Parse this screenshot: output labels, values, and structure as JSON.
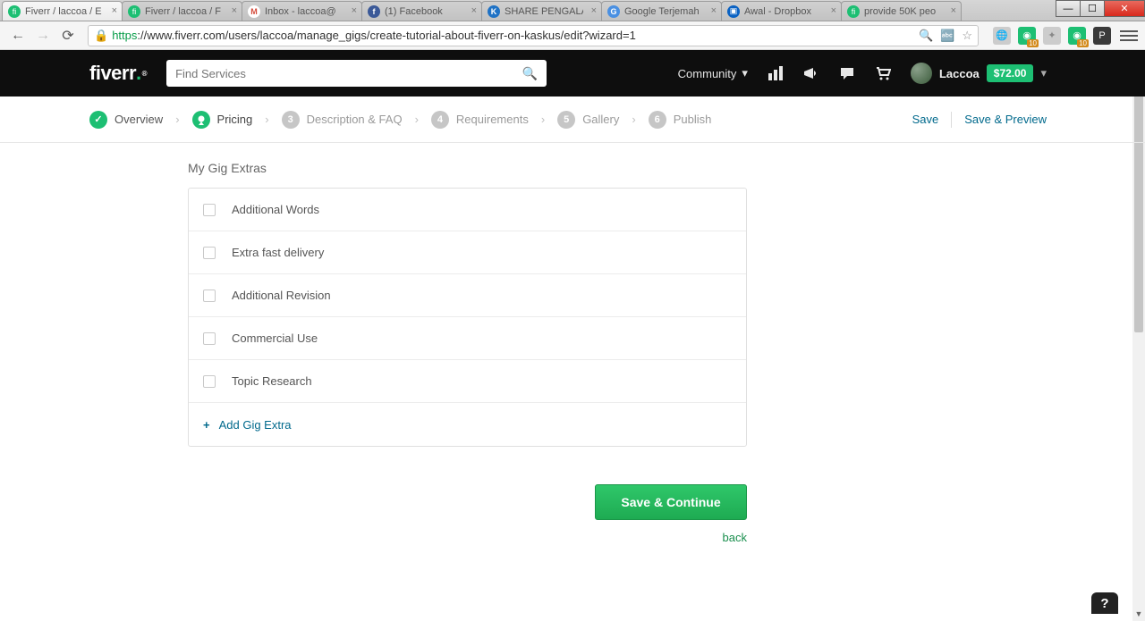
{
  "browser": {
    "tabs": [
      {
        "title": "Fiverr / laccoa / E",
        "favicon": "#1dbf73",
        "letter": "fi"
      },
      {
        "title": "Fiverr / laccoa / F",
        "favicon": "#1dbf73",
        "letter": "fi"
      },
      {
        "title": "Inbox - laccoa@",
        "favicon": "#ffffff",
        "letter": "M",
        "letterColor": "#d44a3a"
      },
      {
        "title": "(1) Facebook",
        "favicon": "#3b5998",
        "letter": "f"
      },
      {
        "title": "SHARE PENGALA",
        "favicon": "#1f72c5",
        "letter": "K"
      },
      {
        "title": "Google Terjemah",
        "favicon": "#4a90e2",
        "letter": "G"
      },
      {
        "title": "Awal - Dropbox",
        "favicon": "#0a62c3",
        "letter": "▣"
      },
      {
        "title": "provide 50K peo",
        "favicon": "#1dbf73",
        "letter": "fi"
      }
    ],
    "url_proto": "https",
    "url_rest": "://www.fiverr.com/users/laccoa/manage_gigs/create-tutorial-about-fiverr-on-kaskus/edit?wizard=1",
    "extensions": [
      {
        "bg": "#cccccc",
        "letter": "🌐",
        "badge": ""
      },
      {
        "bg": "#1dbf73",
        "letter": "◉",
        "badge": "10"
      },
      {
        "bg": "#cccccc",
        "letter": "✦",
        "badge": ""
      },
      {
        "bg": "#1dbf73",
        "letter": "◉",
        "badge": "10"
      },
      {
        "bg": "#3a3a3a",
        "letter": "P",
        "badge": ""
      }
    ]
  },
  "header": {
    "logo": "fiverr",
    "search_placeholder": "Find Services",
    "community": "Community",
    "username": "Laccoa",
    "balance": "$72.00"
  },
  "wizard": {
    "steps": [
      {
        "label": "Overview",
        "state": "done",
        "num": "✓"
      },
      {
        "label": "Pricing",
        "state": "active",
        "num": "❍"
      },
      {
        "label": "Description & FAQ",
        "state": "",
        "num": "3"
      },
      {
        "label": "Requirements",
        "state": "",
        "num": "4"
      },
      {
        "label": "Gallery",
        "state": "",
        "num": "5"
      },
      {
        "label": "Publish",
        "state": "",
        "num": "6"
      }
    ],
    "save": "Save",
    "save_preview": "Save & Preview"
  },
  "extras": {
    "title": "My Gig Extras",
    "items": [
      "Additional Words",
      "Extra fast delivery",
      "Additional Revision",
      "Commercial Use",
      "Topic Research"
    ],
    "add": "Add Gig Extra"
  },
  "actions": {
    "save_continue": "Save & Continue",
    "back": "back"
  },
  "help": "?"
}
